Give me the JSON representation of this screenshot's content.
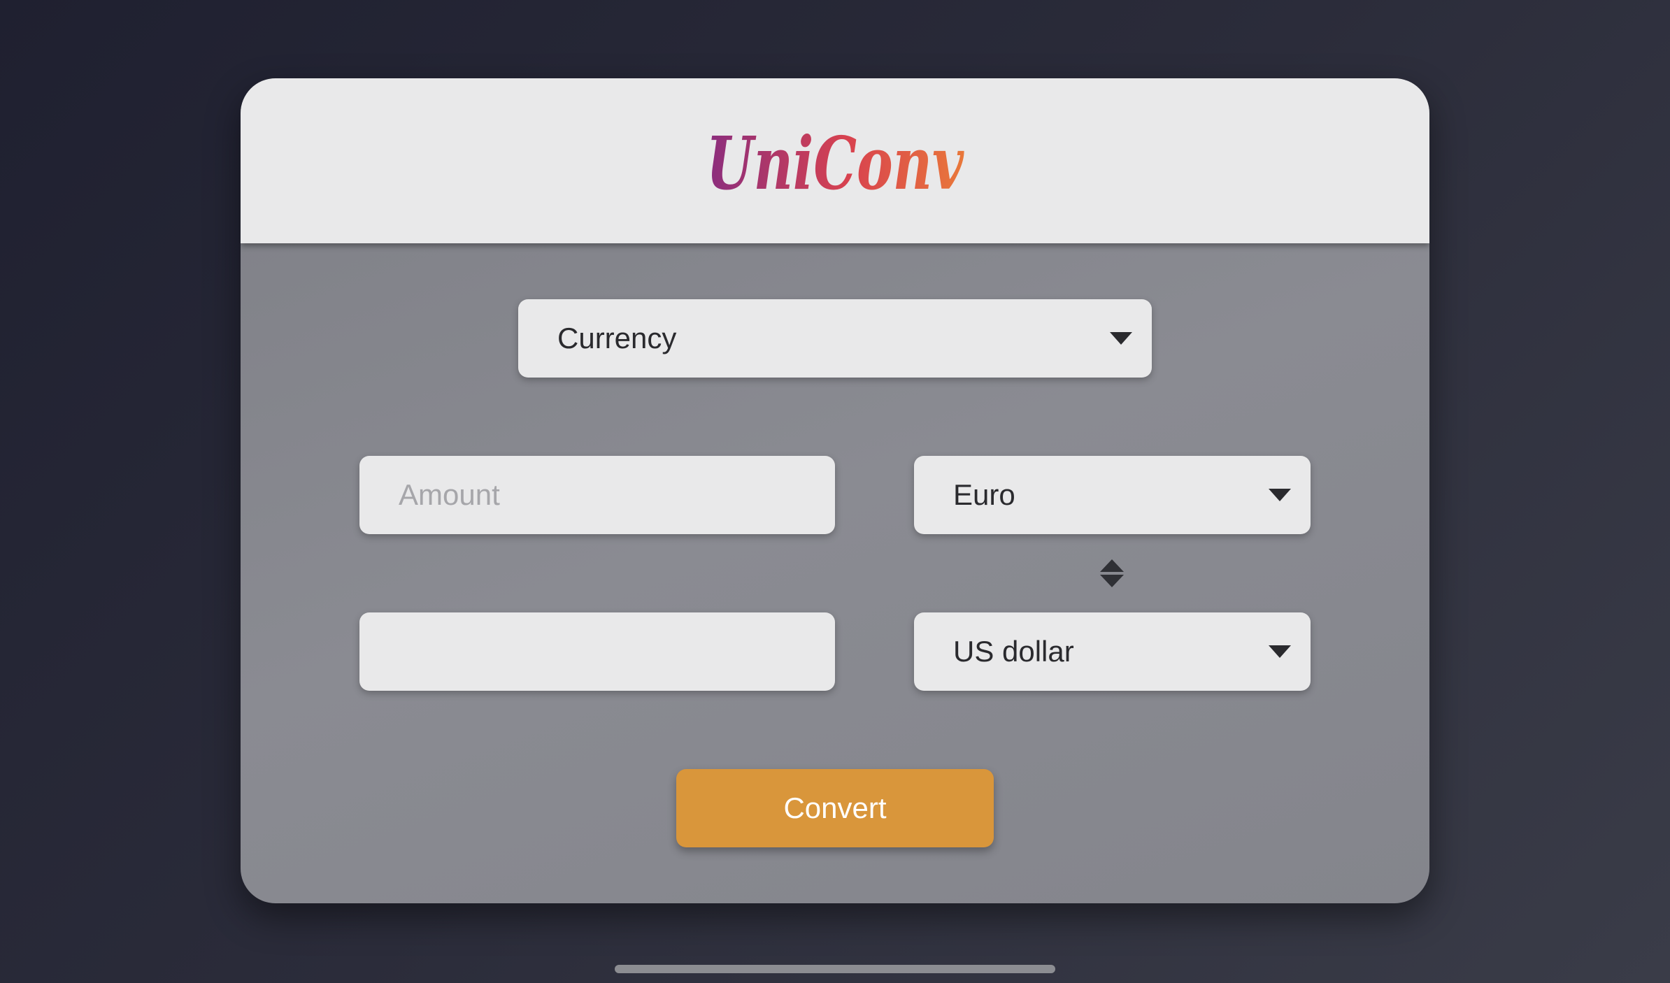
{
  "app": {
    "logo_text": "UniConv"
  },
  "converter": {
    "category": {
      "selected": "Currency",
      "icon": "chevron-down-icon"
    },
    "amount": {
      "value": "",
      "placeholder": "Amount"
    },
    "from_unit": {
      "selected": "Euro",
      "icon": "chevron-down-icon"
    },
    "swap": {
      "icon": "swap-vertical-icon"
    },
    "result": {
      "value": ""
    },
    "to_unit": {
      "selected": "US dollar",
      "icon": "chevron-down-icon"
    },
    "convert_label": "Convert"
  },
  "colors": {
    "accent": "#d9963b",
    "logo_gradient_start": "#8a2d7e",
    "logo_gradient_mid": "#d8424f",
    "logo_gradient_end": "#e9783a",
    "header_bg": "#e9e9ea",
    "panel_bg": "#85868d"
  }
}
